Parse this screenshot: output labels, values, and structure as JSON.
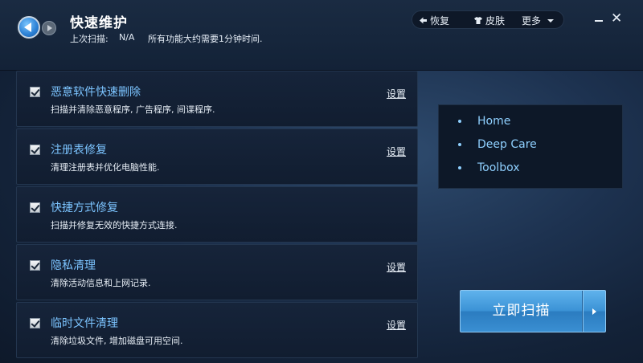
{
  "header": {
    "title": "快速维护",
    "last_scan_label": "上次扫描:",
    "last_scan_value": "N/A",
    "note": "所有功能大约需要1分钟时间."
  },
  "toolbar": {
    "restore_label": "恢复",
    "skin_label": "皮肤",
    "more_label": "更多"
  },
  "tasks": [
    {
      "title": "恶意软件快速删除",
      "desc": "扫描并清除恶意程序, 广告程序, 间谍程序.",
      "settings": "设置",
      "checked": true
    },
    {
      "title": "注册表修复",
      "desc": "清理注册表并优化电脑性能.",
      "settings": "设置",
      "checked": true
    },
    {
      "title": "快捷方式修复",
      "desc": "扫描并修复无效的快捷方式连接.",
      "settings": "",
      "checked": true
    },
    {
      "title": "隐私清理",
      "desc": "清除活动信息和上网记录.",
      "settings": "设置",
      "checked": true
    },
    {
      "title": "临时文件清理",
      "desc": "清除垃圾文件, 增加磁盘可用空间.",
      "settings": "设置",
      "checked": true
    }
  ],
  "nav": {
    "items": [
      {
        "label": "Home"
      },
      {
        "label": "Deep Care"
      },
      {
        "label": "Toolbox"
      }
    ]
  },
  "scan_button": {
    "label": "立即扫描"
  },
  "colors": {
    "accent_blue": "#7cc4ff",
    "button_blue": "#3c93d6",
    "panel_dark": "#111d30"
  }
}
